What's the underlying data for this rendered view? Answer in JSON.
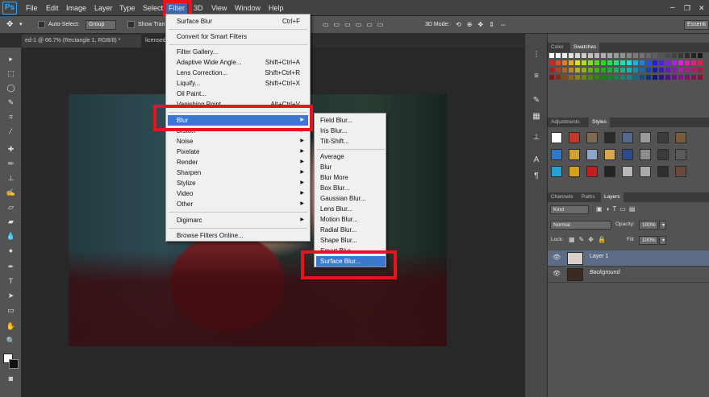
{
  "app": {
    "logo": "Ps"
  },
  "menubar": [
    "File",
    "Edit",
    "Image",
    "Layer",
    "Type",
    "Select",
    "Filter",
    "3D",
    "View",
    "Window",
    "Help"
  ],
  "options": {
    "auto_select_label": "Auto-Select:",
    "auto_select_value": "Group",
    "show_transform_label": "Show Tran",
    "mode_3d_label": "3D Mode:",
    "workspace_label": "Essenti"
  },
  "document_tabs": [
    {
      "label": "ed-1 @ 66.7% (Rectangle 1, RGB/8) *"
    },
    {
      "label": "licensed"
    }
  ],
  "filter_menu": {
    "items": [
      {
        "label": "Surface Blur",
        "shortcut": "Ctrl+F"
      },
      {
        "label": "Convert for Smart Filters",
        "shortcut": ""
      },
      {
        "label": "Filter Gallery...",
        "shortcut": ""
      },
      {
        "label": "Adaptive Wide Angle...",
        "shortcut": "Shift+Ctrl+A"
      },
      {
        "label": "Lens Correction...",
        "shortcut": "Shift+Ctrl+R"
      },
      {
        "label": "Liquify...",
        "shortcut": "Shift+Ctrl+X"
      },
      {
        "label": "Oil Paint...",
        "shortcut": ""
      },
      {
        "label": "Vanishing Point...",
        "shortcut": "Alt+Ctrl+V"
      },
      {
        "label": "Blur",
        "shortcut": ""
      },
      {
        "label": "Distort",
        "shortcut": ""
      },
      {
        "label": "Noise",
        "shortcut": ""
      },
      {
        "label": "Pixelate",
        "shortcut": ""
      },
      {
        "label": "Render",
        "shortcut": ""
      },
      {
        "label": "Sharpen",
        "shortcut": ""
      },
      {
        "label": "Stylize",
        "shortcut": ""
      },
      {
        "label": "Video",
        "shortcut": ""
      },
      {
        "label": "Other",
        "shortcut": ""
      },
      {
        "label": "Digimarc",
        "shortcut": ""
      },
      {
        "label": "Browse Filters Online...",
        "shortcut": ""
      }
    ]
  },
  "blur_submenu": {
    "items": [
      "Field Blur...",
      "Iris Blur...",
      "Tilt-Shift...",
      "Average",
      "Blur",
      "Blur More",
      "Box Blur...",
      "Gaussian Blur...",
      "Lens Blur...",
      "Motion Blur...",
      "Radial Blur...",
      "Shape Blur...",
      "Smart Blur...",
      "Surface Blur..."
    ],
    "highlighted": "Surface Blur..."
  },
  "panels": {
    "color_tabs": [
      "Color",
      "Swatches"
    ],
    "adjust_tabs": [
      "Adjustments",
      "Styles"
    ],
    "layer_tabs": [
      "Channels",
      "Paths",
      "Layers"
    ],
    "kind_label": "Kind",
    "blend_mode": "Normal",
    "opacity_label": "Opacity:",
    "opacity_value": "100%",
    "lock_label": "Lock:",
    "fill_label": "Fill:",
    "fill_value": "100%",
    "layers": [
      {
        "name": "Layer 1",
        "selected": true
      },
      {
        "name": "Background",
        "selected": false
      }
    ]
  },
  "colors": {
    "highlight": "#3d78d0",
    "annotation_red": "#e8141b",
    "brand": "#31a8ff"
  }
}
